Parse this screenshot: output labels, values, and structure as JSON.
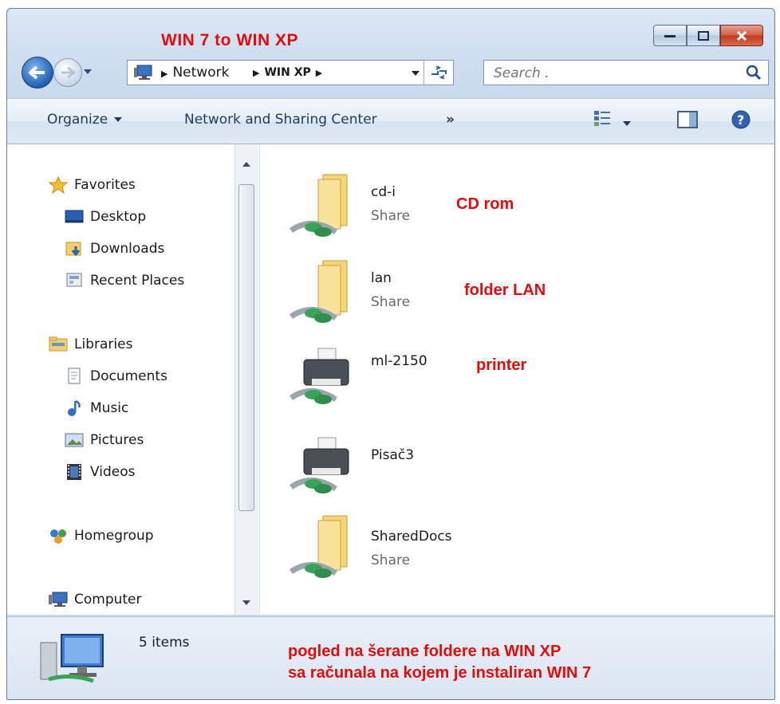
{
  "window": {
    "title": "WIN 7  to  WIN XP",
    "controls": {
      "minimize": "minimize-icon",
      "maximize": "maximize-icon",
      "close": "close-icon"
    }
  },
  "address": {
    "crumb_network": "Network",
    "crumb_current": "WIN XP",
    "search_placeholder": "Search ."
  },
  "toolbar": {
    "organize": "Organize",
    "network_sharing": "Network and Sharing Center",
    "more": "»"
  },
  "sidebar": {
    "favorites": {
      "label": "Favorites",
      "items": [
        {
          "label": "Desktop"
        },
        {
          "label": "Downloads"
        },
        {
          "label": "Recent Places"
        }
      ]
    },
    "libraries": {
      "label": "Libraries",
      "items": [
        {
          "label": "Documents"
        },
        {
          "label": "Music"
        },
        {
          "label": "Pictures"
        },
        {
          "label": "Videos"
        }
      ]
    },
    "homegroup": "Homegroup",
    "computer": "Computer"
  },
  "items": [
    {
      "name": "cd-i",
      "type": "Share",
      "icon": "shared-folder-icon",
      "note": "CD rom"
    },
    {
      "name": "lan",
      "type": "Share",
      "icon": "shared-folder-icon",
      "note": "folder LAN"
    },
    {
      "name": "ml-2150",
      "type": "",
      "icon": "shared-printer-icon",
      "note": "printer"
    },
    {
      "name": "Pisač3",
      "type": "",
      "icon": "shared-printer-icon",
      "note": ""
    },
    {
      "name": "SharedDocs",
      "type": "Share",
      "icon": "shared-folder-icon",
      "note": ""
    }
  ],
  "status": {
    "count": "5 items",
    "note_line1": "pogled na šerane foldere na WIN XP",
    "note_line2": "sa računala na kojem je instaliran WIN 7"
  },
  "colors": {
    "annotation": "#e60b0b",
    "accent": "#1e395b"
  }
}
